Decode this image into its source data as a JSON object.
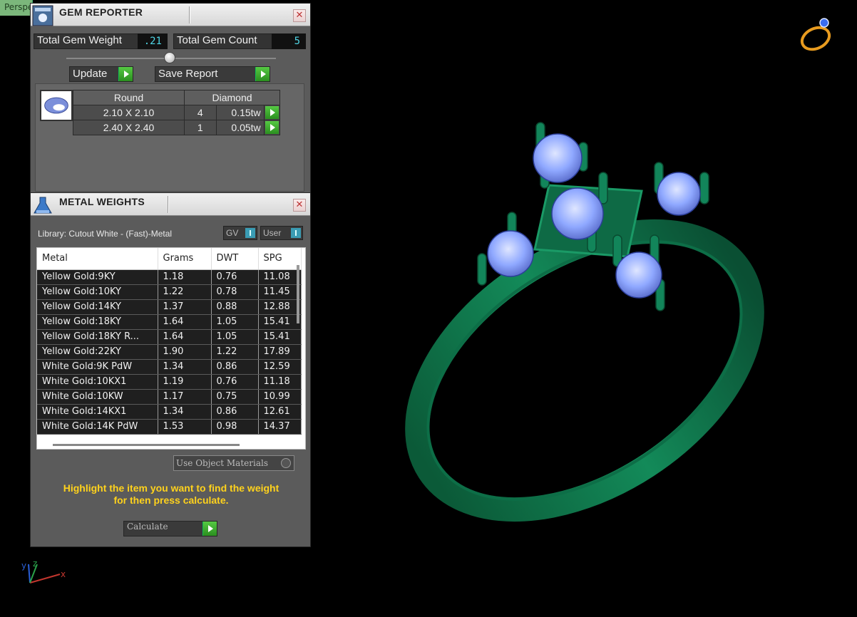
{
  "viewport": {
    "tab_label": "Perspective"
  },
  "gem_reporter": {
    "title": "GEM REPORTER",
    "close": "✕",
    "total_weight_label": "Total Gem Weight",
    "total_weight_value": ".21",
    "total_count_label": "Total Gem Count",
    "total_count_value": "5",
    "update_label": "Update",
    "save_label": "Save Report",
    "headers": [
      "Round",
      "Diamond"
    ],
    "rows": [
      {
        "size": "2.10 X 2.10",
        "count": "4",
        "weight": "0.15tw"
      },
      {
        "size": "2.40 X 2.40",
        "count": "1",
        "weight": "0.05tw"
      }
    ]
  },
  "metal_weights": {
    "title": "METAL WEIGHTS",
    "close": "✕",
    "library": "Library: Cutout White - (Fast)-Metal",
    "toggle_gv": "GV",
    "toggle_user": "User",
    "columns": [
      "Metal",
      "Grams",
      "DWT",
      "SPG"
    ],
    "rows": [
      [
        "Yellow Gold:9KY",
        "1.18",
        "0.76",
        "11.08"
      ],
      [
        "Yellow Gold:10KY",
        "1.22",
        "0.78",
        "11.45"
      ],
      [
        "Yellow Gold:14KY",
        "1.37",
        "0.88",
        "12.88"
      ],
      [
        "Yellow Gold:18KY",
        "1.64",
        "1.05",
        "15.41"
      ],
      [
        "Yellow Gold:18KY R...",
        "1.64",
        "1.05",
        "15.41"
      ],
      [
        "Yellow Gold:22KY",
        "1.90",
        "1.22",
        "17.89"
      ],
      [
        "White Gold:9K PdW",
        "1.34",
        "0.86",
        "12.59"
      ],
      [
        "White Gold:10KX1",
        "1.19",
        "0.76",
        "11.18"
      ],
      [
        "White Gold:10KW",
        "1.17",
        "0.75",
        "10.99"
      ],
      [
        "White Gold:14KX1",
        "1.34",
        "0.86",
        "12.61"
      ],
      [
        "White Gold:14K PdW",
        "1.53",
        "0.98",
        "14.37"
      ]
    ],
    "use_object_materials": "Use Object Materials",
    "hint_line1": "Highlight the item you want to find the weight",
    "hint_line2": "for then press calculate.",
    "calculate_label": "Calculate"
  },
  "axis": {
    "x": "x",
    "y": "y",
    "z": "z"
  },
  "colors": {
    "ring": "#0f6b45",
    "gem": "#8fa8ff",
    "hint": "#ffd21c",
    "go": "#3aa82a"
  }
}
